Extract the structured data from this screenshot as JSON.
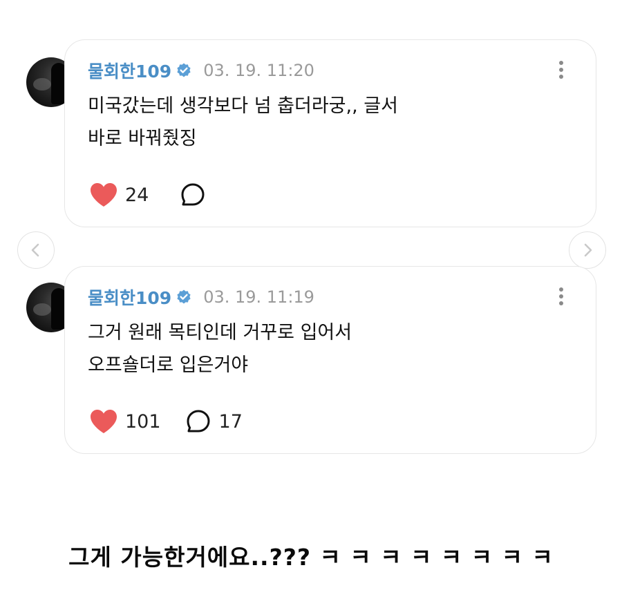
{
  "comments": [
    {
      "username": "물회한109",
      "timestamp": "03. 19. 11:20",
      "lines": [
        "미국갔는데 생각보다 넘 춥더라궁,, 글서",
        "바로 바꿔줬징"
      ],
      "likes": "24",
      "replies": ""
    },
    {
      "username": "물회한109",
      "timestamp": "03. 19. 11:19",
      "lines": [
        "그거 원래 목티인데 거꾸로 입어서",
        "오프숄더로 입은거야"
      ],
      "likes": "101",
      "replies": "17"
    }
  ],
  "caption": "그게 가능한거에요..??? ㅋ ㅋ ㅋ ㅋ ㅋ ㅋ ㅋ ㅋ",
  "icons": {
    "like": "heart-icon",
    "reply": "comment-bubble-icon",
    "verified": "verified-badge-icon",
    "more": "more-vertical-icon",
    "prev": "chevron-left-icon",
    "next": "chevron-right-icon"
  },
  "colors": {
    "username": "#4a8ec6",
    "verified": "#5b9fd6",
    "heart": "#eb5a5a",
    "timestamp": "#9a9a9a",
    "card_border": "#e6e6e6"
  }
}
